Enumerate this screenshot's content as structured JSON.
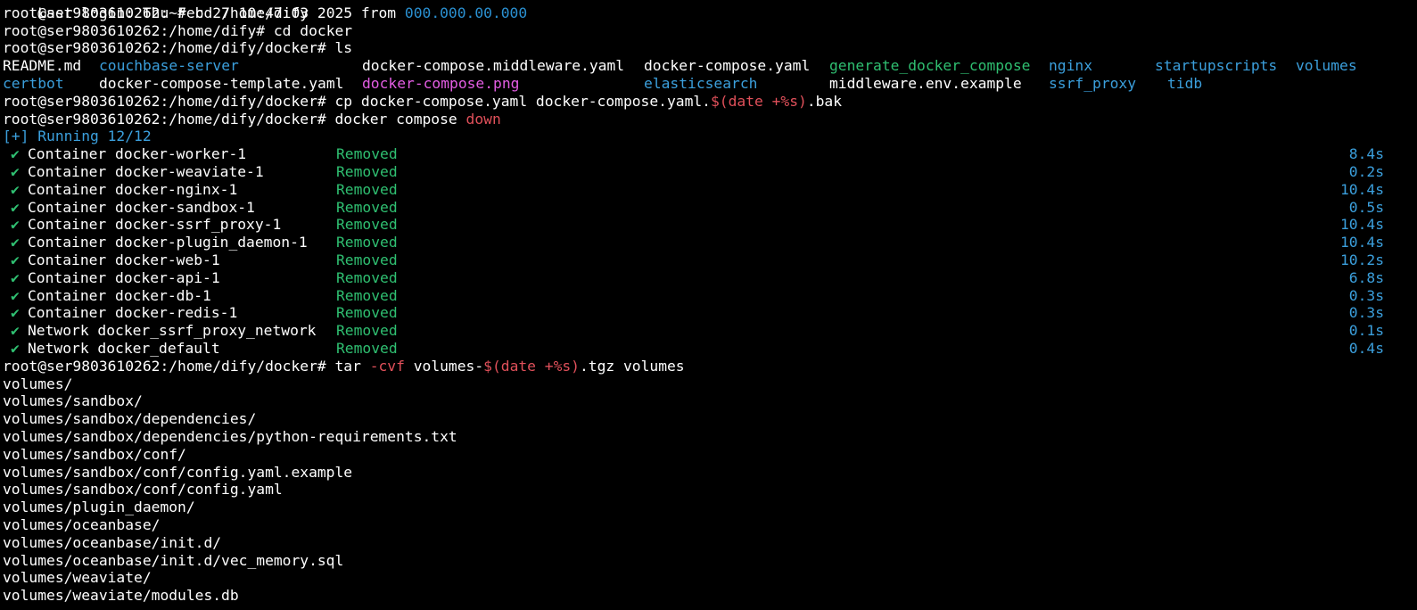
{
  "colors": {
    "background": "#000000",
    "text": "#ffffff",
    "directory": "#3b9fdc",
    "executable": "#2fbf71",
    "image": "#e35de3",
    "shell_expansion": "#e0505a",
    "status_ok": "#2fbf71",
    "duration": "#3b9fdc"
  },
  "terminal": {
    "top_partial": {
      "text": "Last login: Thu Feb 27 10:47:03 2025 from ",
      "ip": "000.000.00.000"
    },
    "lines_before": [
      {
        "prompt": "root@ser9803610262:~# ",
        "command": "cd /home/dify"
      },
      {
        "prompt": "root@ser9803610262:/home/dify# ",
        "command": "cd docker"
      },
      {
        "prompt": "root@ser9803610262:/home/dify/docker# ",
        "command": "ls"
      }
    ],
    "ls_row1": [
      {
        "name": "README.md",
        "kind": "file"
      },
      {
        "name": "couchbase-server",
        "kind": "directory"
      },
      {
        "name": "docker-compose.middleware.yaml",
        "kind": "file"
      },
      {
        "name": "docker-compose.yaml",
        "kind": "file"
      },
      {
        "name": "generate_docker_compose",
        "kind": "executable"
      },
      {
        "name": "nginx",
        "kind": "directory"
      },
      {
        "name": "startupscripts",
        "kind": "directory"
      },
      {
        "name": "volumes",
        "kind": "directory"
      }
    ],
    "ls_row2": [
      {
        "name": "certbot",
        "kind": "directory"
      },
      {
        "name": "docker-compose-template.yaml",
        "kind": "file"
      },
      {
        "name": "docker-compose.png",
        "kind": "image"
      },
      {
        "name": "elasticsearch",
        "kind": "directory"
      },
      {
        "name": "middleware.env.example",
        "kind": "file"
      },
      {
        "name": "ssrf_proxy",
        "kind": "directory"
      },
      {
        "name": "tidb",
        "kind": "directory"
      }
    ],
    "cp_command": {
      "prompt": "root@ser9803610262:/home/dify/docker# ",
      "before": "cp docker-compose.yaml docker-compose.yaml.",
      "expansion": "$(date +%s)",
      "after": ".bak"
    },
    "down_command": {
      "prompt": "root@ser9803610262:/home/dify/docker# ",
      "before": "docker compose ",
      "highlight": "down"
    },
    "running_header": "[+] Running 12/12",
    "check_glyph": "✔",
    "resources": [
      {
        "label": "Container docker-worker-1",
        "state": "Removed",
        "time": "8.4s"
      },
      {
        "label": "Container docker-weaviate-1",
        "state": "Removed",
        "time": "0.2s"
      },
      {
        "label": "Container docker-nginx-1",
        "state": "Removed",
        "time": "10.4s"
      },
      {
        "label": "Container docker-sandbox-1",
        "state": "Removed",
        "time": "0.5s"
      },
      {
        "label": "Container docker-ssrf_proxy-1",
        "state": "Removed",
        "time": "10.4s"
      },
      {
        "label": "Container docker-plugin_daemon-1",
        "state": "Removed",
        "time": "10.4s"
      },
      {
        "label": "Container docker-web-1",
        "state": "Removed",
        "time": "10.2s"
      },
      {
        "label": "Container docker-api-1",
        "state": "Removed",
        "time": "6.8s"
      },
      {
        "label": "Container docker-db-1",
        "state": "Removed",
        "time": "0.3s"
      },
      {
        "label": "Container docker-redis-1",
        "state": "Removed",
        "time": "0.3s"
      },
      {
        "label": "Network docker_ssrf_proxy_network",
        "state": "Removed",
        "time": "0.1s"
      },
      {
        "label": "Network docker_default",
        "state": "Removed",
        "time": "0.4s"
      }
    ],
    "tar_command": {
      "prompt": "root@ser9803610262:/home/dify/docker# ",
      "before": "tar ",
      "flag": "-cvf",
      "mid": " volumes-",
      "expansion": "$(date +%s)",
      "after": ".tgz volumes"
    },
    "tar_output": [
      "volumes/",
      "volumes/sandbox/",
      "volumes/sandbox/dependencies/",
      "volumes/sandbox/dependencies/python-requirements.txt",
      "volumes/sandbox/conf/",
      "volumes/sandbox/conf/config.yaml.example",
      "volumes/sandbox/conf/config.yaml",
      "volumes/plugin_daemon/",
      "volumes/oceanbase/",
      "volumes/oceanbase/init.d/",
      "volumes/oceanbase/init.d/vec_memory.sql",
      "volumes/weaviate/",
      "volumes/weaviate/modules.db"
    ]
  }
}
